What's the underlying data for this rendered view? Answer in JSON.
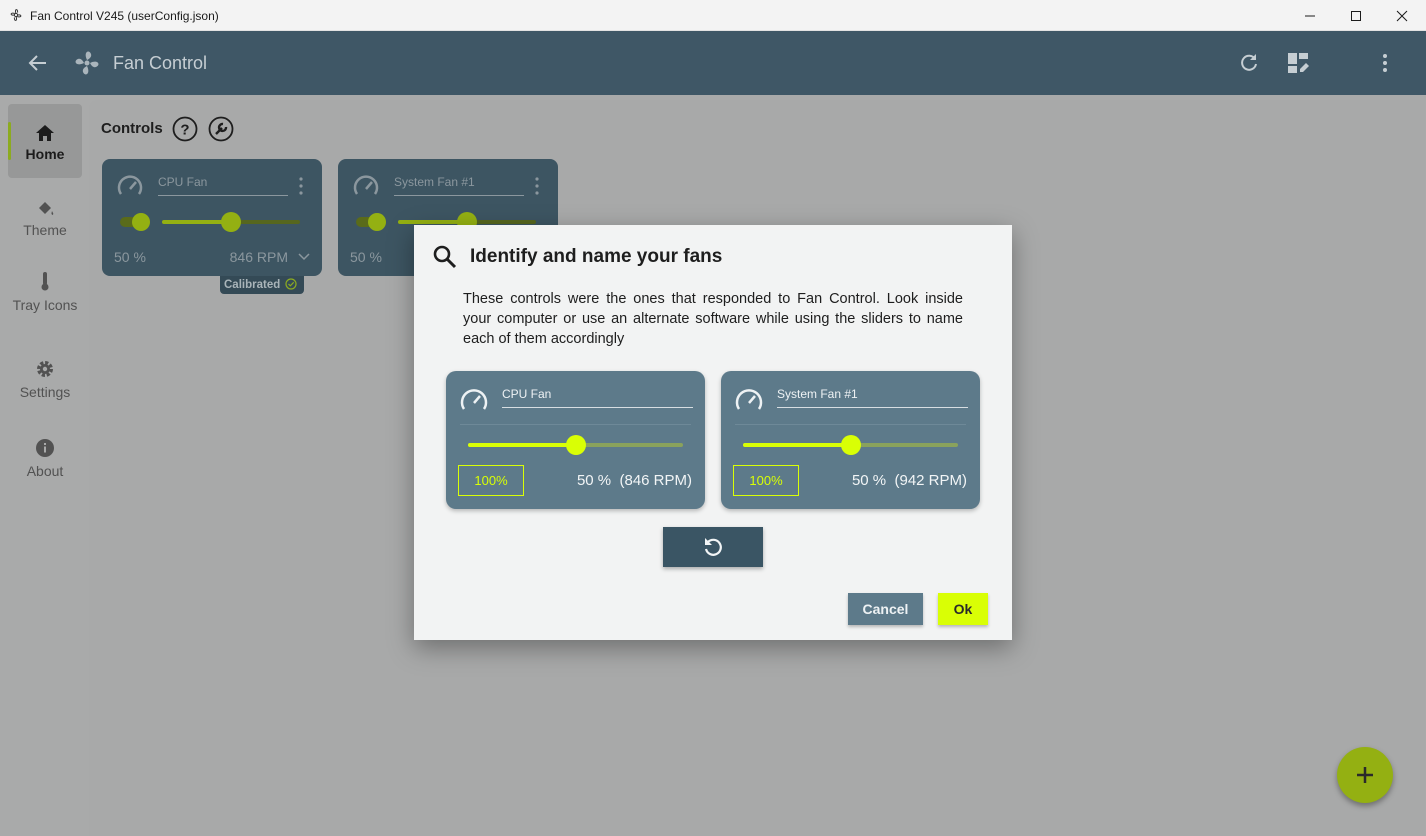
{
  "window": {
    "title": "Fan Control V245 (userConfig.json)",
    "app_icon": "fan-outline-icon"
  },
  "appbar": {
    "title": "Fan Control",
    "icons": [
      "back-arrow-icon",
      "fan-logo-icon",
      "refresh-icon",
      "dashboard-edit-icon",
      "more-vert-icon"
    ]
  },
  "nav": {
    "items": [
      {
        "label": "Home",
        "icon": "home-icon",
        "active": true
      },
      {
        "label": "Theme",
        "icon": "paint-bucket-icon"
      },
      {
        "label": "Tray Icons",
        "icon": "thermometer-icon"
      },
      {
        "label": "Settings",
        "icon": "gear-icon"
      },
      {
        "label": "About",
        "icon": "info-icon"
      }
    ]
  },
  "main": {
    "section_title": "Controls",
    "cards": [
      {
        "name": "CPU Fan",
        "percent": "50 %",
        "rpm": "846 RPM",
        "level": 0.5,
        "badge": "Calibrated"
      },
      {
        "name": "System Fan #1",
        "percent": "50 %",
        "level": 0.5
      }
    ]
  },
  "dialog": {
    "title": "Identify and name your fans",
    "description": "These controls were the ones that responded to Fan Control. Look inside your computer or use an alternate software while using the sliders to name each of them accordingly",
    "fans": [
      {
        "name": "CPU Fan",
        "button": "100%",
        "reading": "50 %  (846 RPM)",
        "level": 0.5
      },
      {
        "name": "System Fan #1",
        "button": "100%",
        "reading": "50 %  (942 RPM)",
        "level": 0.5
      }
    ],
    "cancel_label": "Cancel",
    "ok_label": "Ok"
  },
  "colors": {
    "header": "#3f5766",
    "accent": "#d9ff05",
    "card": "#5d7a8a"
  }
}
